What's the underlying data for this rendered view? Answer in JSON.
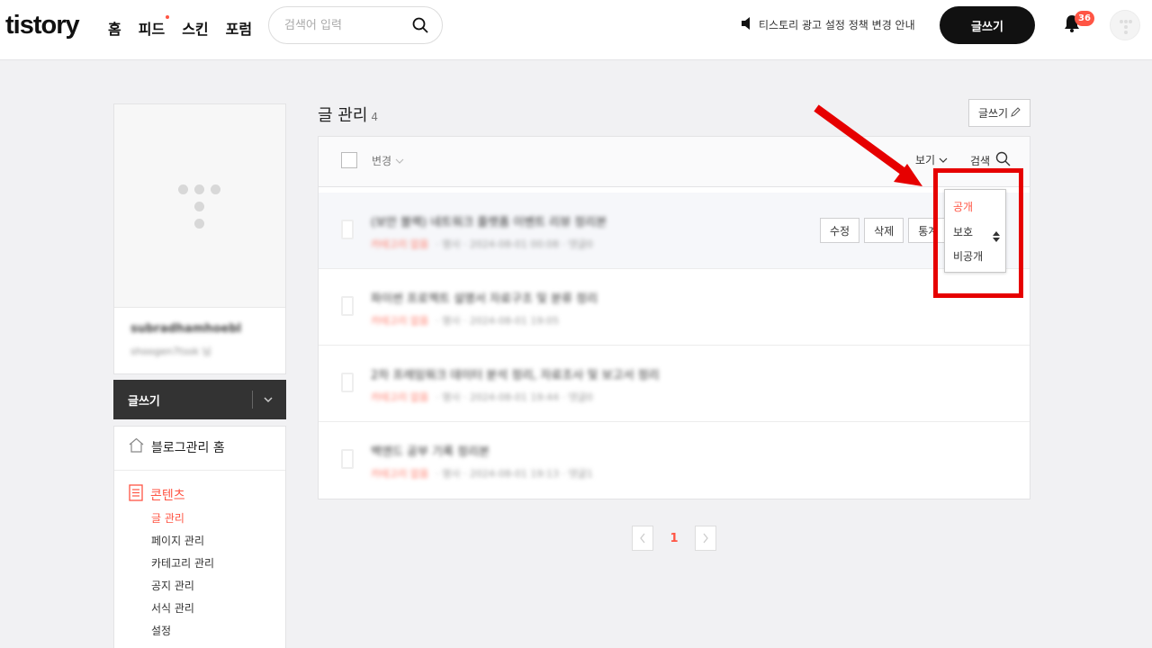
{
  "header": {
    "logo": "tistory",
    "nav": [
      "홈",
      "피드",
      "스킨",
      "포럼"
    ],
    "search_placeholder": "검색어 입력",
    "notice": "티스토리 광고 설정 정책 변경 안내",
    "write_label": "글쓰기",
    "notification_count": "36"
  },
  "sidebar": {
    "blog_name": "subradhamhoebl",
    "blog_addr": "shoogen7tssk 님",
    "write_label": "글쓰기",
    "home_label": "블로그관리 홈",
    "contents_label": "콘텐츠",
    "submenu": [
      "글 관리",
      "페이지 관리",
      "카테고리 관리",
      "공지 관리",
      "서식 관리",
      "설정"
    ]
  },
  "main": {
    "title": "글 관리",
    "count": "4",
    "write_button": "글쓰기",
    "change_label": "변경",
    "view_label": "보기",
    "search_label": "검색",
    "posts": [
      {
        "title": "(보안 블랙) 네트워크 플랫폼 이벤트 리뷰 정리본",
        "category": "카테고리 없음",
        "meta": "· 명사 · 2024-08-01 00:08 · 댓글0"
      },
      {
        "title": "파이썬 프로젝트 설명서 자료구조 및 분류 정리",
        "category": "카테고리 없음",
        "meta": "· 명사 · 2024-08-01 19:05"
      },
      {
        "title": "2차 프레임워크 데이터 분석 정리, 자료조사 및 보고서 정리",
        "category": "카테고리 없음",
        "meta": "· 명사 · 2024-08-01 19:44 · 댓글0"
      },
      {
        "title": "백엔드 공부 기록 정리본",
        "category": "카테고리 없음",
        "meta": "· 명사 · 2024-08-01 19:13 · 댓글1"
      }
    ],
    "row_actions": [
      "수정",
      "삭제",
      "통계"
    ],
    "visibility_options": [
      "공개",
      "보호",
      "비공개"
    ],
    "page": "1"
  },
  "colors": {
    "accent": "#ff5544",
    "highlight": "#e60000"
  }
}
